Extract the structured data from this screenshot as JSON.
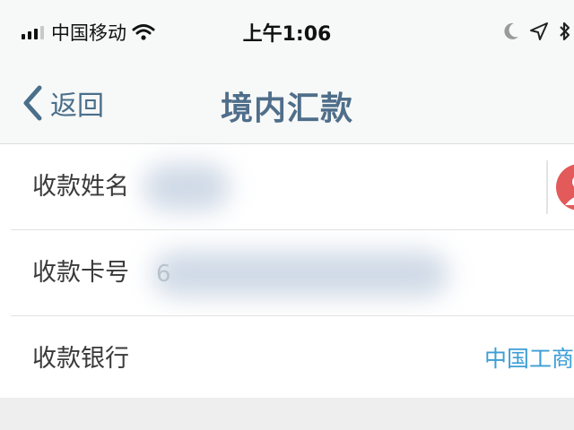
{
  "status_bar": {
    "carrier": "中国移动",
    "time": "上午1:06",
    "icons": [
      "signal-bars-icon",
      "wifi-icon",
      "moon-icon",
      "location-arrow-icon",
      "bluetooth-icon"
    ]
  },
  "nav": {
    "back_label": "返回",
    "title": "境内汇款"
  },
  "form": {
    "payee_name": {
      "label": "收款姓名",
      "value": ""
    },
    "card_number": {
      "label": "收款卡号",
      "value": "6"
    },
    "bank": {
      "label": "收款银行",
      "value": "中国工商银行"
    }
  },
  "colors": {
    "accent_blue": "#3d9ed6",
    "nav_title": "#4f6e8a",
    "contact_icon": "#e25a5a",
    "bar_background": "#f7f8f8"
  }
}
